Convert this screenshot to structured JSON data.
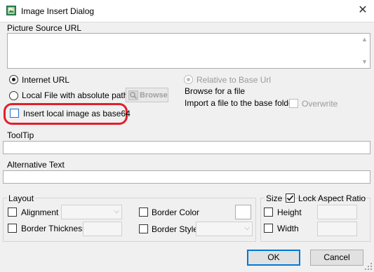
{
  "window": {
    "title": "Image Insert Dialog",
    "close_glyph": "✕"
  },
  "picture_source": {
    "label": "Picture Source URL",
    "value": ""
  },
  "source_options": {
    "internet_url": {
      "label": "Internet URL",
      "selected": true
    },
    "local_file": {
      "label": "Local File with absolute path",
      "selected": false
    },
    "browse_button": {
      "label": "Browse",
      "icon": "magnifier-icon",
      "enabled": false
    },
    "relative_to_base": {
      "label": "Relative to Base Url",
      "enabled": false
    },
    "browse_for_file": {
      "label": "Browse for a file"
    },
    "import_file": {
      "label": "Import a file to the base folder"
    },
    "overwrite": {
      "label": "Overwrite",
      "checked": false,
      "enabled": false
    },
    "insert_base64": {
      "label": "Insert local image as base64",
      "checked": false
    }
  },
  "tooltip": {
    "label": "ToolTip",
    "value": ""
  },
  "alt_text": {
    "label": "Alternative Text",
    "value": ""
  },
  "layout": {
    "legend": "Layout",
    "alignment": {
      "label": "Alignment",
      "checked": false,
      "value": ""
    },
    "border_thickness": {
      "label": "Border Thickness",
      "checked": false,
      "value": ""
    },
    "border_color": {
      "label": "Border Color",
      "checked": false
    },
    "border_style": {
      "label": "Border Style",
      "checked": false,
      "value": ""
    }
  },
  "size": {
    "legend": "Size",
    "lock_aspect": {
      "label": "Lock Aspect Ratio",
      "checked": true
    },
    "height": {
      "label": "Height",
      "checked": false,
      "value": ""
    },
    "width": {
      "label": "Width",
      "checked": false,
      "value": ""
    }
  },
  "buttons": {
    "ok": "OK",
    "cancel": "Cancel"
  },
  "colors": {
    "highlight": "#e0202a",
    "accent": "#0078d7"
  }
}
